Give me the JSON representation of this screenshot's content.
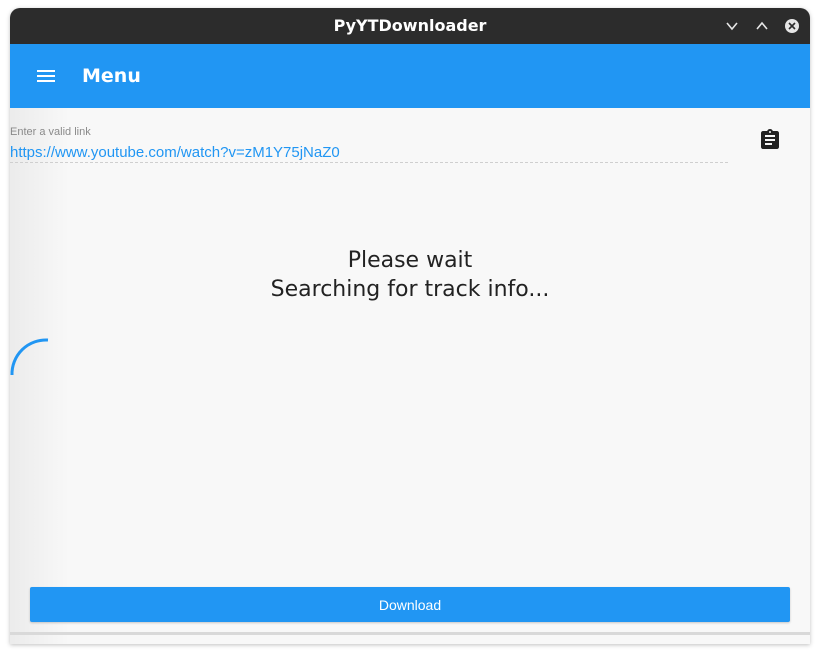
{
  "window": {
    "title": "PyYTDownloader",
    "controls": [
      "chevron-down-icon",
      "chevron-up-icon",
      "close-icon"
    ]
  },
  "appbar": {
    "menu_icon": "hamburger-menu-icon",
    "title": "Menu",
    "color": "#2196f3"
  },
  "link_field": {
    "label": "Enter a valid link",
    "value": "https://www.youtube.com/watch?v=zM1Y75jNaZ0",
    "paste_icon": "clipboard-icon"
  },
  "status": {
    "line1": "Please wait",
    "line2": "Searching for track info..."
  },
  "spinner": {
    "icon": "loading-spinner-icon",
    "color": "#2196f3"
  },
  "download_button": {
    "label": "Download"
  }
}
